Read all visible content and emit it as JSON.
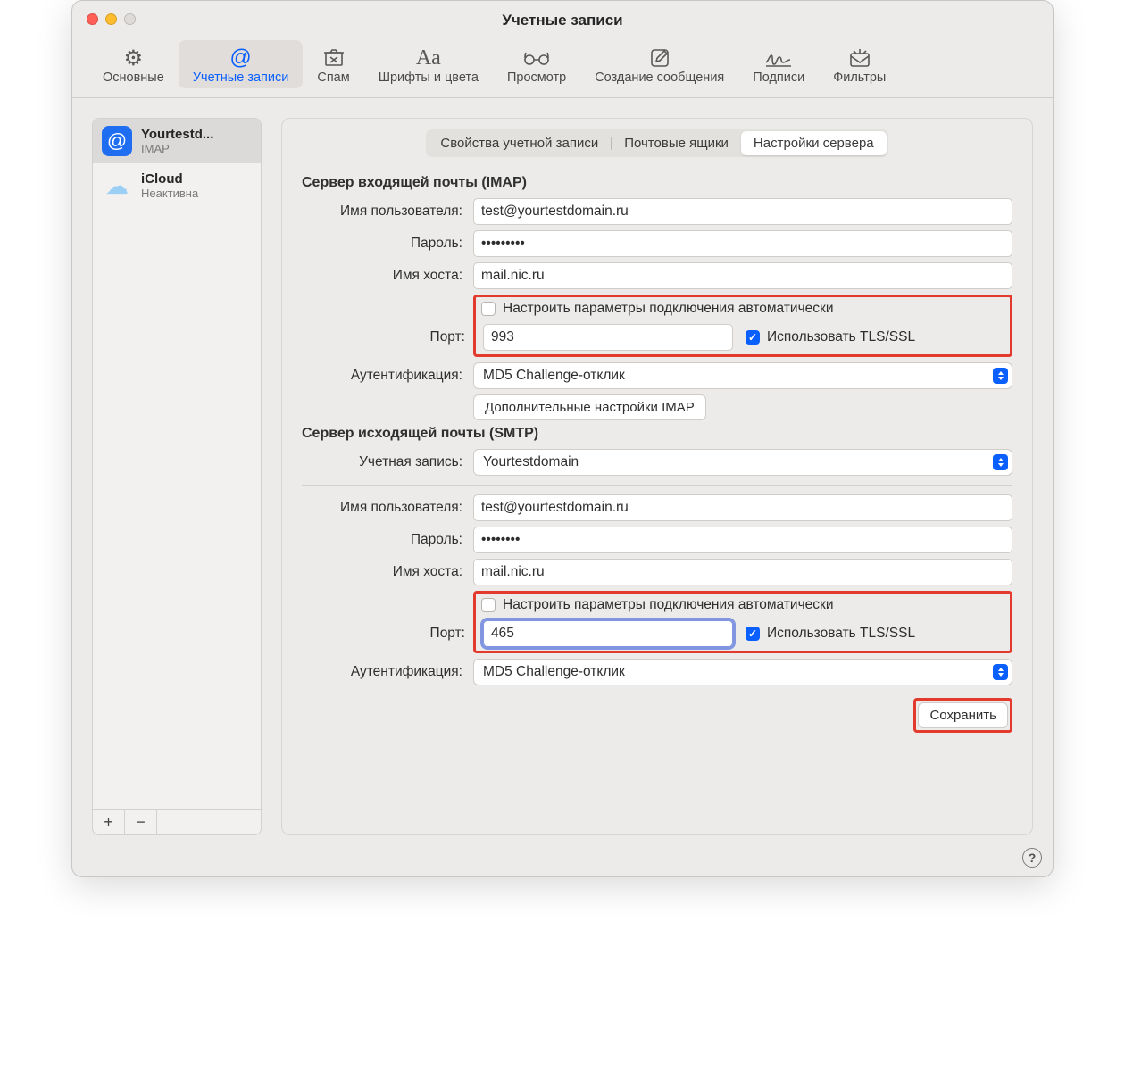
{
  "window": {
    "title": "Учетные записи"
  },
  "toolbar": {
    "items": [
      {
        "label": "Основные"
      },
      {
        "label": "Учетные записи"
      },
      {
        "label": "Спам"
      },
      {
        "label": "Шрифты и цвета"
      },
      {
        "label": "Просмотр"
      },
      {
        "label": "Создание сообщения"
      },
      {
        "label": "Подписи"
      },
      {
        "label": "Фильтры"
      }
    ]
  },
  "sidebar": {
    "accounts": [
      {
        "name": "Yourtestd...",
        "sub": "IMAP"
      },
      {
        "name": "iCloud",
        "sub": "Неактивна"
      }
    ],
    "plus": "+",
    "minus": "−"
  },
  "tabs": {
    "info": "Свойства учетной записи",
    "boxes": "Почтовые ящики",
    "server": "Настройки сервера"
  },
  "incoming": {
    "heading": "Сервер входящей почты (IMAP)",
    "user_label": "Имя пользователя:",
    "user_value": "test@yourtestdomain.ru",
    "pass_label": "Пароль:",
    "pass_value": "•••••••••",
    "host_label": "Имя хоста:",
    "host_value": "mail.nic.ru",
    "auto_label": "Настроить параметры подключения автоматически",
    "port_label": "Порт:",
    "port_value": "993",
    "tls_label": "Использовать TLS/SSL",
    "auth_label": "Аутентификация:",
    "auth_value": "MD5 Challenge-отклик",
    "advanced_btn": "Дополнительные настройки IMAP"
  },
  "outgoing": {
    "heading": "Сервер исходящей почты (SMTP)",
    "account_label": "Учетная запись:",
    "account_value": "Yourtestdomain",
    "user_label": "Имя пользователя:",
    "user_value": "test@yourtestdomain.ru",
    "pass_label": "Пароль:",
    "pass_value": "••••••••",
    "host_label": "Имя хоста:",
    "host_value": "mail.nic.ru",
    "auto_label": "Настроить параметры подключения автоматически",
    "port_label": "Порт:",
    "port_value": "465",
    "tls_label": "Использовать TLS/SSL",
    "auth_label": "Аутентификация:",
    "auth_value": "MD5 Challenge-отклик"
  },
  "save_btn": "Сохранить",
  "help": "?"
}
